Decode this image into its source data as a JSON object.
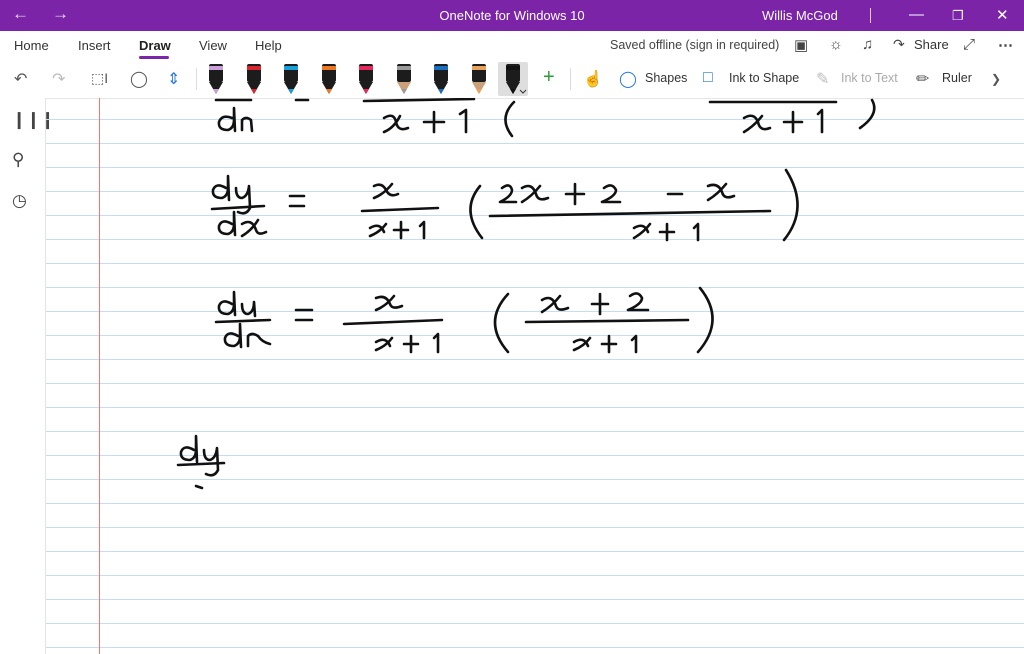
{
  "titlebar": {
    "back_icon": "arrow-left-icon",
    "forward_icon": "arrow-right-icon",
    "title": "OneNote for Windows 10",
    "user": "Willis McGod",
    "minimize_icon": "minimize-icon",
    "restore_icon": "restore-icon",
    "close_icon": "close-icon",
    "background": "#7b24a8"
  },
  "menu": {
    "tabs": [
      {
        "label": "Home"
      },
      {
        "label": "Insert"
      },
      {
        "label": "Draw",
        "active": true
      },
      {
        "label": "View"
      },
      {
        "label": "Help"
      }
    ],
    "status": "Saved offline (sign in required)",
    "share_label": "Share"
  },
  "toolbar": {
    "shapes_label": "Shapes",
    "ink_to_shape_label": "Ink to Shape",
    "ink_to_text_label": "Ink to Text",
    "ruler_label": "Ruler",
    "pens": [
      {
        "color": "#c9a0dc",
        "kind": "highlighter"
      },
      {
        "color": "#d9262e",
        "kind": "pen"
      },
      {
        "color": "#1aa0d8",
        "kind": "pen"
      },
      {
        "color": "#f07820",
        "kind": "pen"
      },
      {
        "color": "#e8275d",
        "kind": "highlighter"
      },
      {
        "color": "#9a9a9a",
        "kind": "pencil"
      },
      {
        "color": "#1a6fbf",
        "kind": "pen"
      },
      {
        "color": "#e9a35c",
        "kind": "pencil"
      },
      {
        "color": "#111111",
        "kind": "pen",
        "selected": true
      }
    ]
  },
  "leftbar": {
    "notebooks_icon": "notebooks-icon",
    "search_icon": "search-icon",
    "recent_icon": "clock-icon"
  },
  "page": {
    "line_color": "#c8dcee",
    "margin_color": "#ee7777"
  }
}
